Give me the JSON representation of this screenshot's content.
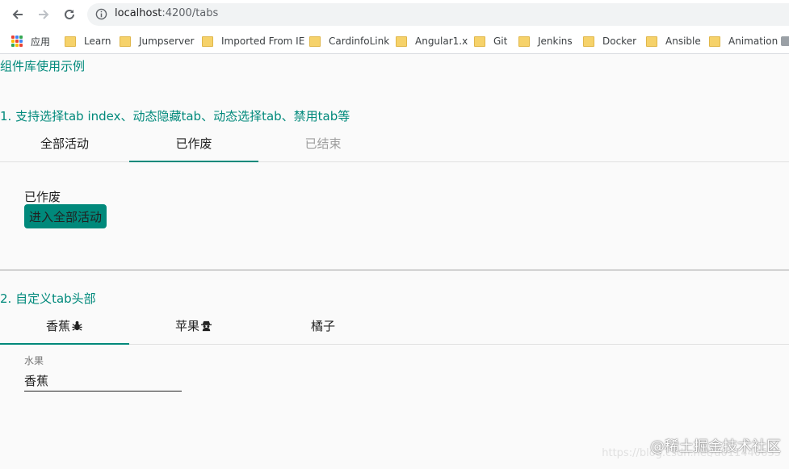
{
  "browser": {
    "url_host": "localhost",
    "url_path": ":4200/tabs",
    "bookmarks": [
      "应用",
      "Learn",
      "Jumpserver",
      "Imported From IE",
      "CardinfoLink",
      "Angular1.x",
      "Git",
      "Jenkins",
      "Docker",
      "Ansible",
      "Animation"
    ]
  },
  "page": {
    "title": "组件库使用示例",
    "section1": {
      "title": "1. 支持选择tab index、动态隐藏tab、动态选择tab、禁用tab等",
      "tabs": [
        {
          "label": "全部活动",
          "state": "normal"
        },
        {
          "label": "已作废",
          "state": "active"
        },
        {
          "label": "已结束",
          "state": "disabled"
        }
      ],
      "panel_text": "已作废",
      "button_label": "进入全部活动"
    },
    "section2": {
      "title": "2. 自定义tab头部",
      "tabs": [
        {
          "label": "香蕉",
          "icon": "bug-icon",
          "state": "active"
        },
        {
          "label": "苹果",
          "icon": "spy-icon",
          "state": "normal"
        },
        {
          "label": "橘子",
          "state": "normal"
        }
      ],
      "field_label": "水果",
      "field_value": "香蕉"
    },
    "watermark": "@稀土掘金技术社区",
    "watermark_url": "https://blog.csdn.net/u011440635"
  },
  "colors": {
    "accent": "#00897b",
    "folder": "#f6d26a"
  }
}
